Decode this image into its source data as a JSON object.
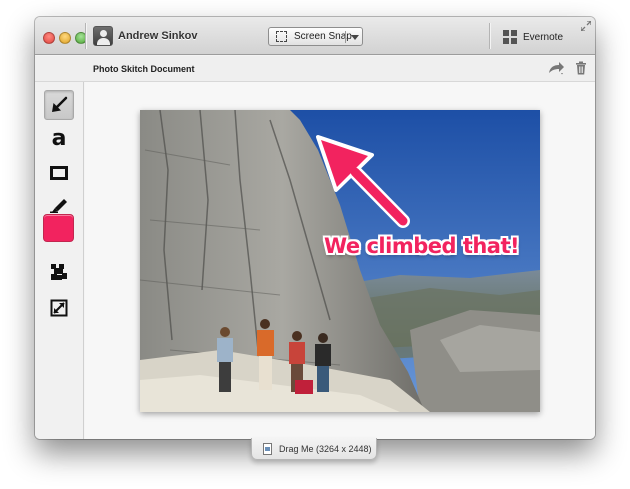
{
  "titlebar": {
    "username": "Andrew Sinkov",
    "snap_button_label": "Screen Snap",
    "evernote_label": "Evernote"
  },
  "docbar": {
    "title": "Photo Skitch Document"
  },
  "tools": [
    {
      "name": "arrow-tool",
      "icon": "arrow-icon",
      "active": true
    },
    {
      "name": "text-tool",
      "label": "a",
      "icon": "text-icon"
    },
    {
      "name": "shape-tool",
      "icon": "rectangle-icon"
    },
    {
      "name": "marker-tool",
      "icon": "marker-icon"
    },
    {
      "name": "color-picker",
      "color": "#f2235f"
    },
    {
      "name": "pixelate-tool",
      "icon": "pixelate-icon"
    },
    {
      "name": "crop-resize-tool",
      "icon": "resize-icon"
    }
  ],
  "annotation": {
    "text": "We climbed that!",
    "color": "#f2235f"
  },
  "drag": {
    "label": "Drag Me (3264 x 2448)"
  }
}
